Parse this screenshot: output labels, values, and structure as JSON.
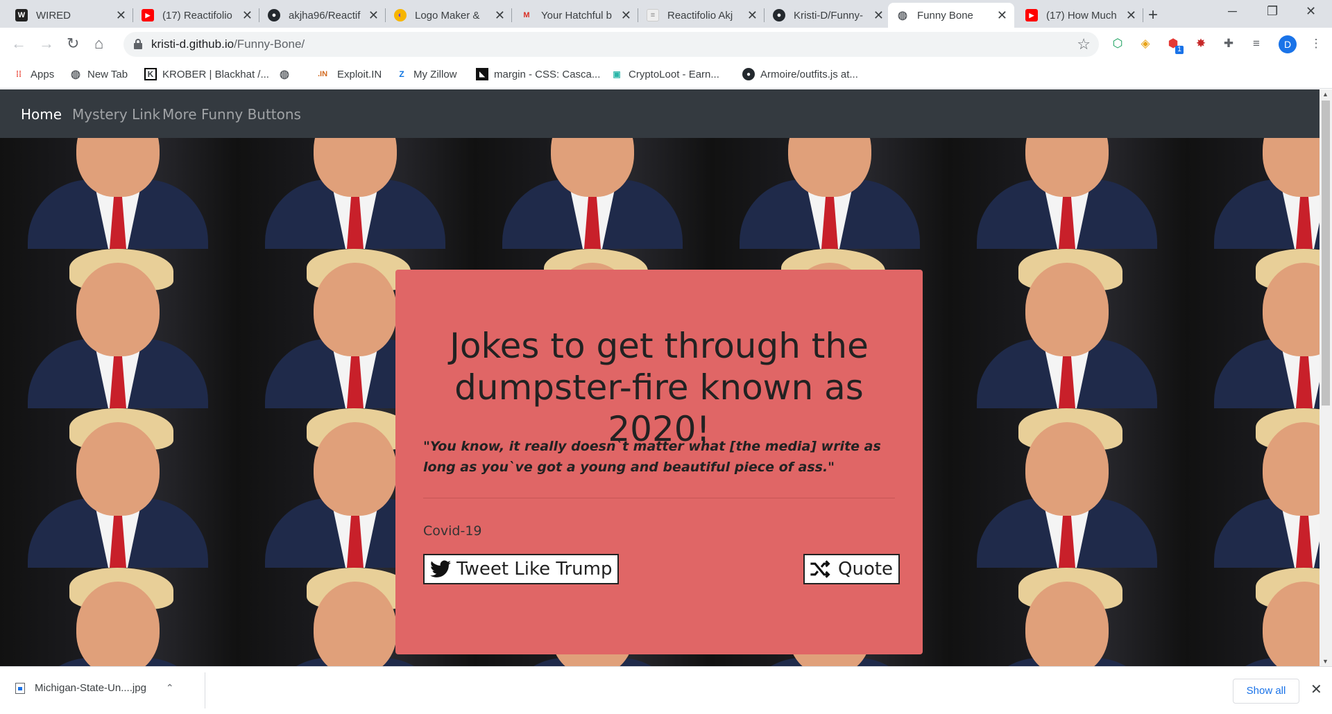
{
  "browser": {
    "tabs": [
      {
        "title": "WIRED",
        "icon": "wired-icon"
      },
      {
        "title": "(17) Reactifolio",
        "icon": "youtube-icon"
      },
      {
        "title": "akjha96/Reactif",
        "icon": "github-icon"
      },
      {
        "title": "Logo Maker & ",
        "icon": "logo-maker-icon"
      },
      {
        "title": "Your Hatchful b",
        "icon": "gmail-icon"
      },
      {
        "title": "Reactifolio Akj",
        "icon": "page-icon"
      },
      {
        "title": "Kristi-D/Funny-",
        "icon": "github-icon"
      },
      {
        "title": "Funny Bone",
        "icon": "globe-icon",
        "active": true
      },
      {
        "title": "(17) How Much",
        "icon": "youtube-icon"
      }
    ],
    "url": {
      "host": "kristi-d.github.io",
      "path": "/Funny-Bone/"
    },
    "profile_initial": "D",
    "extension_badge": "1",
    "bookmarks": [
      {
        "label": "Apps",
        "icon": "apps-grid-icon"
      },
      {
        "label": "New Tab",
        "icon": "globe-icon"
      },
      {
        "label": "KROBER | Blackhat /...",
        "icon": "krober-icon"
      },
      {
        "label": "",
        "icon": "globe-icon"
      },
      {
        "label": "Exploit.IN",
        "icon": "exploit-icon"
      },
      {
        "label": "My Zillow",
        "icon": "zillow-icon"
      },
      {
        "label": "margin - CSS: Casca...",
        "icon": "stack-icon"
      },
      {
        "label": "CryptoLoot - Earn...",
        "icon": "cryptoloot-icon"
      },
      {
        "label": "Armoire/outfits.js at...",
        "icon": "github-icon"
      }
    ]
  },
  "site": {
    "nav": {
      "home": "Home",
      "mystery": "Mystery Link",
      "more": "More Funny Buttons"
    },
    "card": {
      "heading": "Jokes to get through the dumpster-fire known as 2020!",
      "quote": "\"You know, it really doesn`t matter what [the media] write as long as you`ve got a young and beautiful piece of ass.\"",
      "author": "Covid-19",
      "tweet_button": "Tweet Like Trump",
      "quote_button": "Quote",
      "background": "#e06666"
    }
  },
  "downloads": {
    "file": "Michigan-State-Un....jpg",
    "show_all": "Show all"
  }
}
